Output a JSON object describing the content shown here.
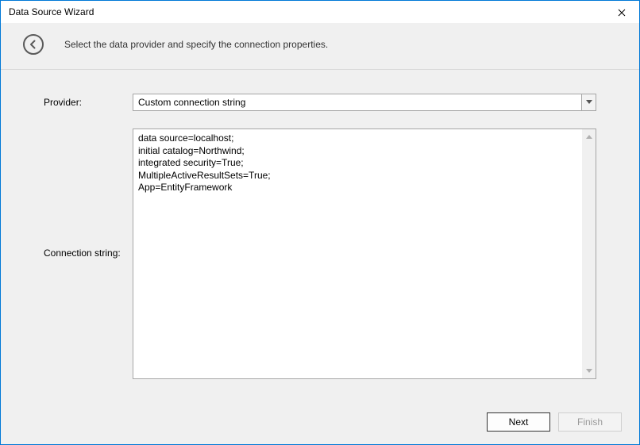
{
  "window": {
    "title": "Data Source Wizard"
  },
  "header": {
    "instruction": "Select the data provider and specify the connection properties."
  },
  "form": {
    "provider_label": "Provider:",
    "provider_value": "Custom connection string",
    "connstr_label": "Connection string:",
    "connstr_value": "data source=localhost;\ninitial catalog=Northwind;\nintegrated security=True;\nMultipleActiveResultSets=True;\nApp=EntityFramework"
  },
  "footer": {
    "next_label": "Next",
    "finish_label": "Finish"
  }
}
